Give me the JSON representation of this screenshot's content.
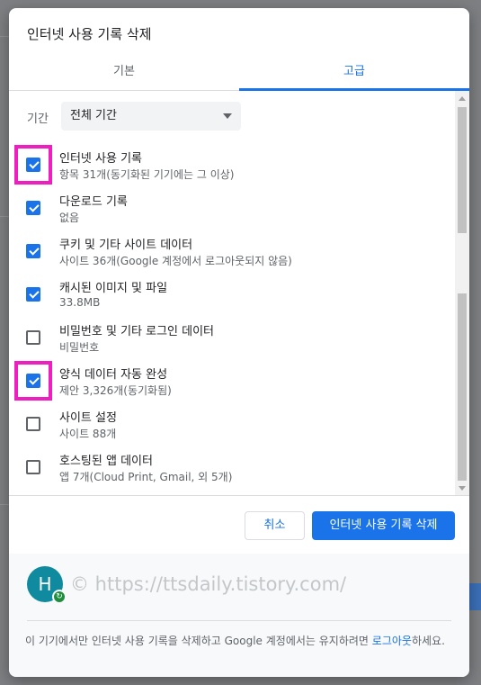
{
  "dialog": {
    "title": "인터넷 사용 기록 삭제",
    "tabs": [
      {
        "label": "기본",
        "active": false
      },
      {
        "label": "고급",
        "active": true
      }
    ],
    "time_range": {
      "label": "기간",
      "selected": "전체 기간"
    },
    "items": [
      {
        "title": "인터넷 사용 기록",
        "subtitle": "항목 31개(동기화된 기기에는 그 이상)",
        "checked": true,
        "highlighted": true
      },
      {
        "title": "다운로드 기록",
        "subtitle": "없음",
        "checked": true,
        "highlighted": false
      },
      {
        "title": "쿠키 및 기타 사이트 데이터",
        "subtitle": "사이트 36개(Google 계정에서 로그아웃되지 않음)",
        "checked": true,
        "highlighted": false
      },
      {
        "title": "캐시된 이미지 및 파일",
        "subtitle": "33.8MB",
        "checked": true,
        "highlighted": false
      },
      {
        "title": "비밀번호 및 기타 로그인 데이터",
        "subtitle": "비밀번호",
        "checked": false,
        "highlighted": false
      },
      {
        "title": "양식 데이터 자동 완성",
        "subtitle": "제안 3,326개(동기화됨)",
        "checked": true,
        "highlighted": true
      },
      {
        "title": "사이트 설정",
        "subtitle": "사이트 88개",
        "checked": false,
        "highlighted": false
      },
      {
        "title": "호스팅된 앱 데이터",
        "subtitle": "앱 7개(Cloud Print, Gmail, 외 5개)",
        "checked": false,
        "highlighted": false
      }
    ],
    "buttons": {
      "cancel": "취소",
      "delete": "인터넷 사용 기록 삭제"
    },
    "footer": {
      "avatar_letter": "H",
      "watermark": "© https://ttsdaily.tistory.com/",
      "text_before": "이 기기에서만 인터넷 사용 기록을 삭제하고 Google 계정에서는 유지하려면 ",
      "link": "로그아웃",
      "text_after": "하세요."
    }
  },
  "colors": {
    "accent": "#1a73e8",
    "highlight": "#ee1ec0",
    "avatar": "#0f8a9e"
  }
}
